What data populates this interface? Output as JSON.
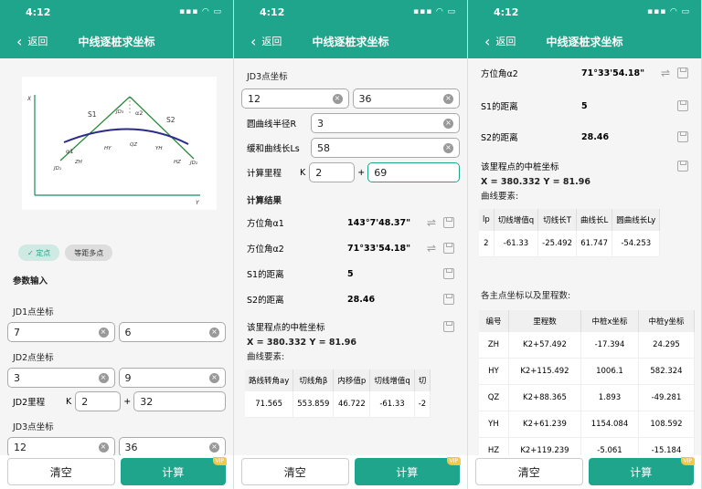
{
  "status": {
    "time": "4:12"
  },
  "nav": {
    "back": "返回",
    "title": "中线逐桩求坐标"
  },
  "diagram": {
    "x_axis": "X",
    "y_axis": "Y",
    "jd": "JD₃",
    "s1": "S1",
    "s2": "S2",
    "a1": "α1",
    "a2": "α2",
    "jd1": "JD₁",
    "jd2": "JD₂",
    "zh": "ZH",
    "hy": "HY",
    "qz": "QZ",
    "yh": "YH",
    "hz": "HZ"
  },
  "mode": {
    "point": "定点",
    "multi": "等距多点"
  },
  "params_title": "参数输入",
  "jd1": {
    "label": "JD1点坐标",
    "x": "7",
    "y": "6"
  },
  "jd2": {
    "label": "JD2点坐标",
    "x": "3",
    "y": "9"
  },
  "jd2_mileage": {
    "label": "JD2里程",
    "k": "K",
    "k_val": "2",
    "plus": "+",
    "m_val": "32"
  },
  "jd3": {
    "label": "JD3点坐标",
    "x": "12",
    "y": "36"
  },
  "radius": {
    "label": "圆曲线半径R",
    "value": "3"
  },
  "ls": {
    "label": "缓和曲线长Ls",
    "value": "58"
  },
  "mileage": {
    "label": "计算里程",
    "k": "K",
    "k_val": "2",
    "plus": "+",
    "m_val": "69"
  },
  "calc_title": "计算结果",
  "results": {
    "a1": {
      "label": "方位角α1",
      "value": "143°7'48.37\""
    },
    "a2": {
      "label": "方位角α2",
      "value": "71°33'54.18\""
    },
    "s1": {
      "label": "S1的距离",
      "value": "5"
    },
    "s2": {
      "label": "S2的距离",
      "value": "28.46"
    }
  },
  "center": {
    "label": "该里程点的中桩坐标",
    "value": "X = 380.332    Y = 81.96"
  },
  "curve_title": "曲线要素:",
  "curve_table": {
    "headers": [
      "路线转角ay",
      "切线角β",
      "内移值p",
      "切线增值q",
      "切"
    ],
    "row": [
      "71.565",
      "553.859",
      "46.722",
      "-61.33",
      "-2"
    ]
  },
  "curve_table2": {
    "headers": [
      "lp",
      "切线增值q",
      "切线长T",
      "曲线长L",
      "圆曲线长Ly"
    ],
    "row": [
      "2",
      "-61.33",
      "-25.492",
      "61.747",
      "-54.253"
    ]
  },
  "main_title": "各主点坐标以及里程数:",
  "main_table": {
    "headers": [
      "编号",
      "里程数",
      "中桩x坐标",
      "中桩y坐标"
    ],
    "rows": [
      [
        "ZH",
        "K2+57.492",
        "-17.394",
        "24.295"
      ],
      [
        "HY",
        "K2+115.492",
        "1006.1",
        "582.324"
      ],
      [
        "QZ",
        "K2+88.365",
        "1.893",
        "-49.281"
      ],
      [
        "YH",
        "K2+61.239",
        "1154.084",
        "108.592"
      ],
      [
        "HZ",
        "K2+119.239",
        "-5.061",
        "-15.184"
      ]
    ]
  },
  "buttons": {
    "clear": "清空",
    "calc": "计算",
    "vip": "VIP"
  }
}
